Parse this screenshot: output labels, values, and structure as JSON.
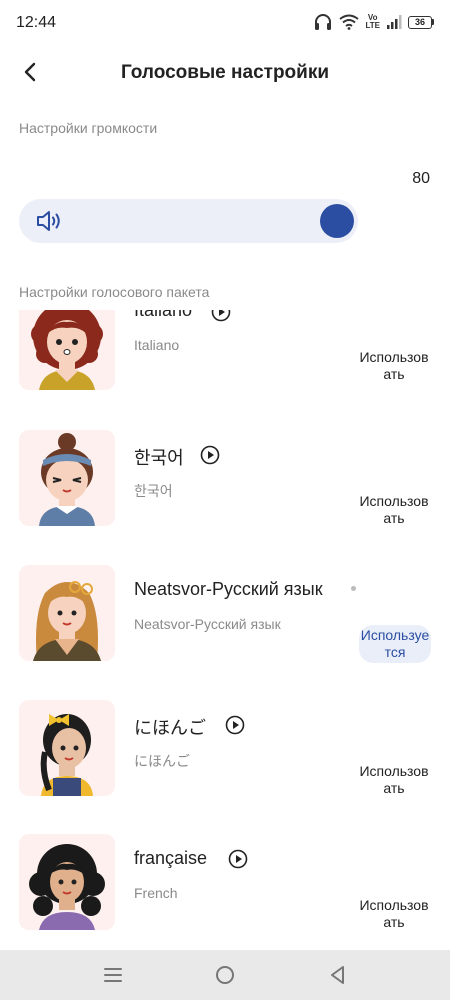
{
  "status_bar": {
    "time": "12:44",
    "volte": "Vo\nLTE",
    "battery": "36",
    "icons": [
      "headphones-icon",
      "wifi-icon",
      "volte-icon",
      "signal-icon",
      "battery-icon"
    ]
  },
  "header": {
    "title": "Голосовые настройки",
    "back_icon": "chevron-left-icon"
  },
  "volume": {
    "section_label": "Настройки громкости",
    "value": "80",
    "level": 0.8,
    "icon": "speaker-icon"
  },
  "voice_pack": {
    "section_label": "Настройки голосового пакета",
    "items": [
      {
        "name": "Italiano",
        "subtitle": "Italiano",
        "action": "Использовать",
        "active": false,
        "icon": "play-icon"
      },
      {
        "name": "한국어",
        "subtitle": "한국어",
        "action": "Использовать",
        "active": false,
        "icon": "play-icon"
      },
      {
        "name": "Neatsvor-Русский язык",
        "subtitle": "Neatsvor-Русский язык",
        "action": "Используется",
        "active": true,
        "icon": "loading-dot-icon"
      },
      {
        "name": "にほんご",
        "subtitle": "にほんご",
        "action": "Использовать",
        "active": false,
        "icon": "play-icon"
      },
      {
        "name": "française",
        "subtitle": "French",
        "action": "Использовать",
        "active": false,
        "icon": "play-icon"
      }
    ]
  },
  "colors": {
    "accent": "#2b4ea2",
    "slider_track": "#eceff8",
    "avatar_bg": "#fdf0ee",
    "nav_bg": "#e9e9e9"
  },
  "nav_bar": {
    "icons": [
      "menu-icon",
      "home-icon",
      "back-icon"
    ]
  }
}
